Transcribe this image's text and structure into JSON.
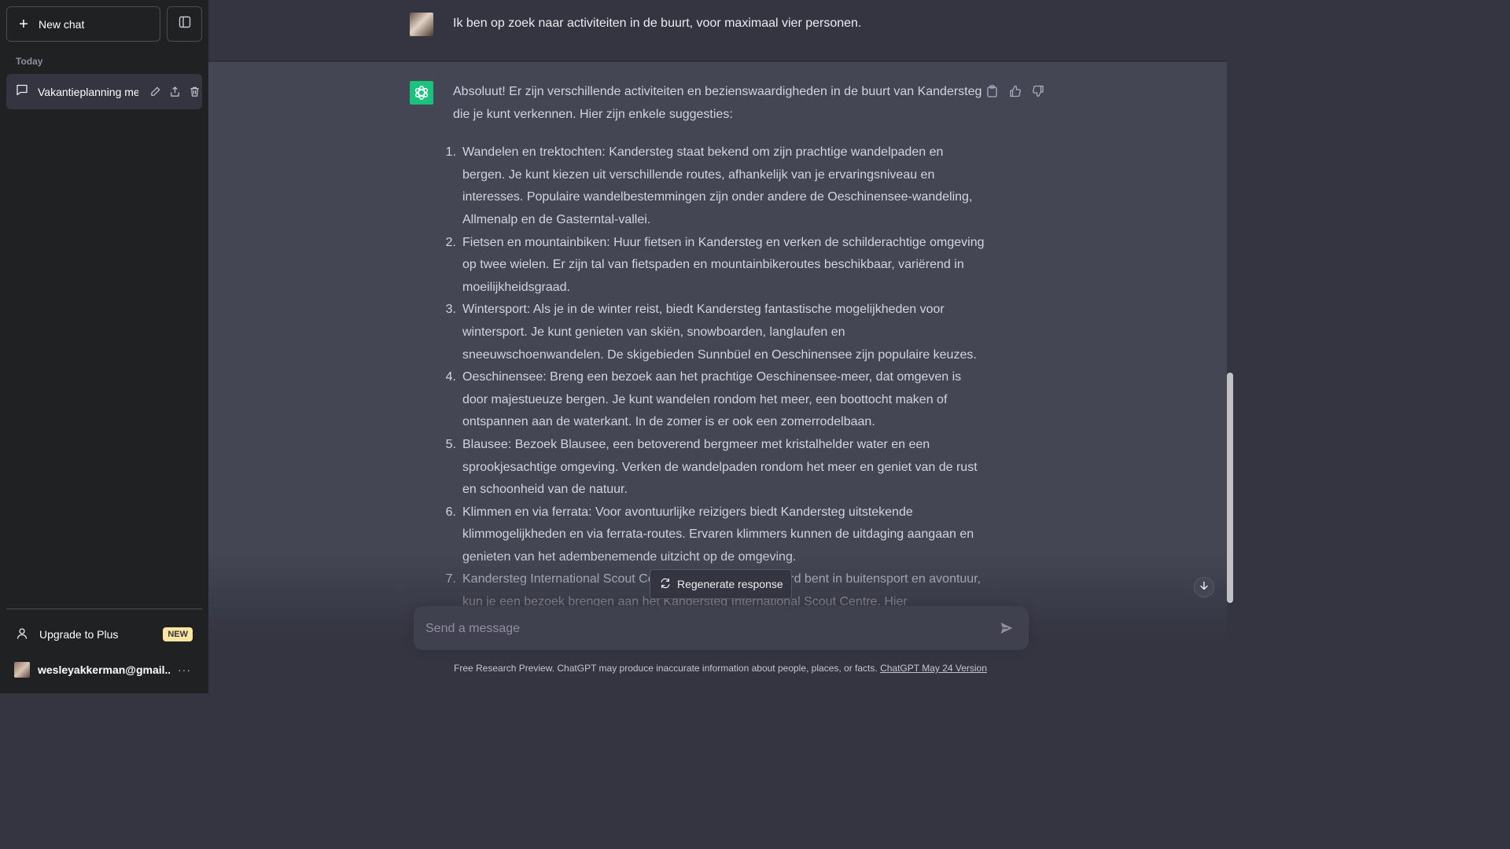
{
  "sidebar": {
    "new_chat_label": "New chat",
    "section_label": "Today",
    "conversation_title": "Vakantieplanning me",
    "upgrade_label": "Upgrade to Plus",
    "upgrade_badge": "NEW",
    "user_email": "wesleyakkerman@gmail....",
    "more_label": "···"
  },
  "chat": {
    "user_message": "Ik ben op zoek naar activiteiten in de buurt, voor maximaal vier personen.",
    "assistant_intro": "Absoluut! Er zijn verschillende activiteiten en bezienswaardigheden in de buurt van Kandersteg die je kunt verkennen. Hier zijn enkele suggesties:",
    "items": [
      {
        "num": "1.",
        "text": "Wandelen en trektochten: Kandersteg staat bekend om zijn prachtige wandelpaden en bergen. Je kunt kiezen uit verschillende routes, afhankelijk van je ervaringsniveau en interesses. Populaire wandelbestemmingen zijn onder andere de Oeschinensee-wandeling, Allmenalp en de Gasterntal-vallei."
      },
      {
        "num": "2.",
        "text": "Fietsen en mountainbiken: Huur fietsen in Kandersteg en verken de schilderachtige omgeving op twee wielen. Er zijn tal van fietspaden en mountainbikeroutes beschikbaar, variërend in moeilijkheidsgraad."
      },
      {
        "num": "3.",
        "text": "Wintersport: Als je in de winter reist, biedt Kandersteg fantastische mogelijkheden voor wintersport. Je kunt genieten van skiën, snowboarden, langlaufen en sneeuwschoenwandelen. De skigebieden Sunnbüel en Oeschinensee zijn populaire keuzes."
      },
      {
        "num": "4.",
        "text": "Oeschinensee: Breng een bezoek aan het prachtige Oeschinensee-meer, dat omgeven is door majestueuze bergen. Je kunt wandelen rondom het meer, een boottocht maken of ontspannen aan de waterkant. In de zomer is er ook een zomerrodelbaan."
      },
      {
        "num": "5.",
        "text": "Blausee: Bezoek Blausee, een betoverend bergmeer met kristalhelder water en een sprookjesachtige omgeving. Verken de wandelpaden rondom het meer en geniet van de rust en schoonheid van de natuur."
      },
      {
        "num": "6.",
        "text": "Klimmen en via ferrata: Voor avontuurlijke reizigers biedt Kandersteg uitstekende klimmogelijkheden en via ferrata-routes. Ervaren klimmers kunnen de uitdaging aangaan en genieten van het adembenemende uitzicht op de omgeving."
      },
      {
        "num": "7.",
        "text": "Kandersteg International Scout Centre: Als je geïnteresseerd bent in buitensport en avontuur, kun je een bezoek brengen aan het Kandersteg International Scout Centre. Hier"
      }
    ]
  },
  "composer": {
    "regenerate_label": "Regenerate response",
    "placeholder": "Send a message"
  },
  "footer": {
    "note": "Free Research Preview. ChatGPT may produce inaccurate information about people, places, or facts.",
    "link": "ChatGPT May 24 Version"
  },
  "colors": {
    "sidebar_bg": "#202123",
    "main_bg": "#343541",
    "assistant_bg": "#444654",
    "gpt_brand": "#19c37d",
    "badge_bg": "#fae69e"
  }
}
